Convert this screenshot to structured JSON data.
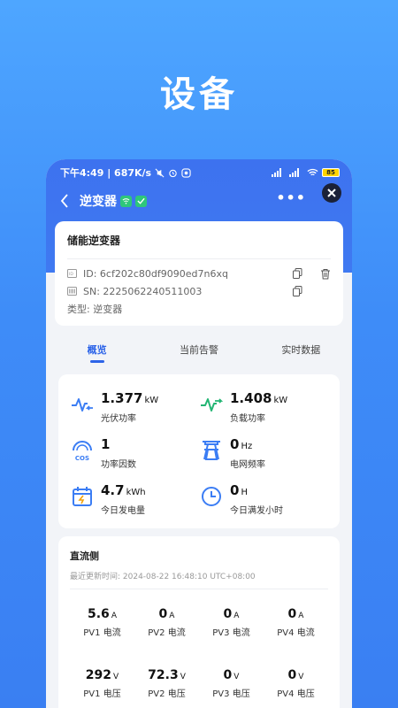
{
  "hero": {
    "title": "设备"
  },
  "status_bar": {
    "time_speed": "下午4:49 | 687K/s",
    "battery": "85"
  },
  "nav": {
    "title": "逆变器",
    "more": "•••"
  },
  "device": {
    "name": "储能逆变器",
    "id": "ID: 6cf202c80df9090ed7n6xq",
    "sn": "SN: 2225062240511003",
    "type": "类型: 逆变器"
  },
  "tabs": [
    "概览",
    "当前告警",
    "实时数据"
  ],
  "metrics": {
    "pv_power": {
      "value": "1.377",
      "unit": "kW",
      "label": "光伏功率"
    },
    "load_power": {
      "value": "1.408",
      "unit": "kW",
      "label": "负载功率"
    },
    "power_factor": {
      "value": "1",
      "unit": "",
      "label": "功率因数",
      "icon_text": "COS"
    },
    "grid_freq": {
      "value": "0",
      "unit": "Hz",
      "label": "电网频率"
    },
    "daily_energy": {
      "value": "4.7",
      "unit": "kWh",
      "label": "今日发电量"
    },
    "full_hours": {
      "value": "0",
      "unit": "H",
      "label": "今日满发小时"
    }
  },
  "dc": {
    "title": "直流侧",
    "updated": "最近更新时间: 2024-08-22 16:48:10 UTC+08:00",
    "cells": [
      {
        "value": "5.6",
        "unit": "A",
        "label": "PV1 电流"
      },
      {
        "value": "0",
        "unit": "A",
        "label": "PV2 电流"
      },
      {
        "value": "0",
        "unit": "A",
        "label": "PV3 电流"
      },
      {
        "value": "0",
        "unit": "A",
        "label": "PV4 电流"
      },
      {
        "value": "292",
        "unit": "V",
        "label": "PV1 电压"
      },
      {
        "value": "72.3",
        "unit": "V",
        "label": "PV2 电压"
      },
      {
        "value": "0",
        "unit": "V",
        "label": "PV3 电压"
      },
      {
        "value": "0",
        "unit": "V",
        "label": "PV4 电压"
      }
    ]
  },
  "colors": {
    "accent": "#2d64e8",
    "header": "#3d72ef",
    "green": "#2fc77a"
  }
}
